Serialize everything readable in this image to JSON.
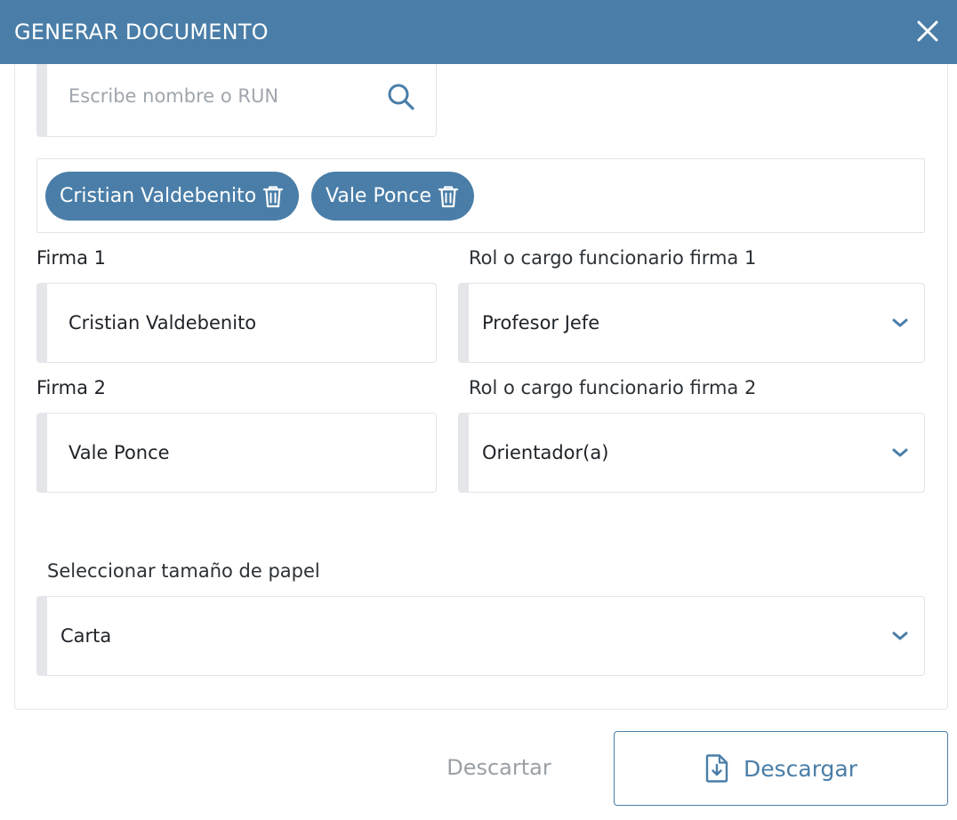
{
  "header": {
    "title": "GENERAR DOCUMENTO",
    "close_icon": "close-icon"
  },
  "search": {
    "placeholder": "Escribe nombre o RUN",
    "icon": "search-icon"
  },
  "chips": [
    {
      "label": "Cristian Valdebenito",
      "icon": "trash-icon"
    },
    {
      "label": "Vale Ponce",
      "icon": "trash-icon"
    }
  ],
  "signatures": [
    {
      "label": "Firma 1",
      "name": "Cristian Valdebenito",
      "role_label": "Rol o cargo funcionario firma 1",
      "role_value": "Profesor Jefe"
    },
    {
      "label": "Firma 2",
      "name": "Vale Ponce",
      "role_label": "Rol o cargo funcionario firma 2",
      "role_value": "Orientador(a)"
    }
  ],
  "paper": {
    "label": "Seleccionar tamaño de papel",
    "value": "Carta"
  },
  "actions": {
    "discard_label": "Descartar",
    "download_label": "Descargar",
    "download_icon": "file-download-icon"
  },
  "colors": {
    "primary": "#4a7ea8",
    "muted_text": "#9aa0a6",
    "field_accent": "#e4e6ea"
  }
}
